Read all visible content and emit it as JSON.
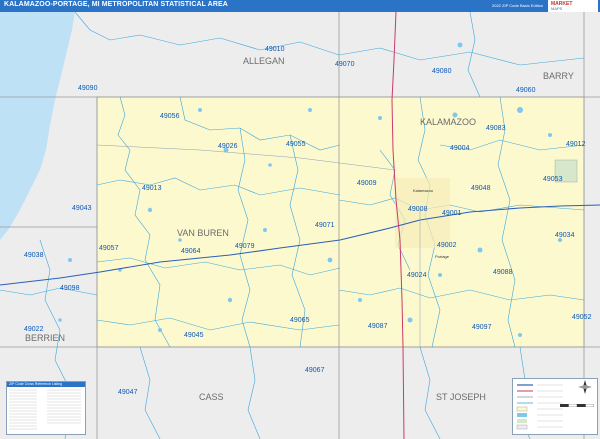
{
  "title": "KALAMAZOO-PORTAGE, MI METROPOLITAN STATISTICAL AREA",
  "edition": "2022 ZIP Code Basic Edition",
  "brand": {
    "line1": "MARKET",
    "line2": "MAPS"
  },
  "colors": {
    "title_bar": "#2b73c7",
    "msa_fill": "#fdf9cf",
    "outside_fill": "#ededed",
    "lake_michigan": "#bfe1f6",
    "zip_boundary": "#39a7dd",
    "county_boundary": "#9a9a9a",
    "highway": "#2c5fb7",
    "us_route": "#c93a6a",
    "zip_label": "#0b58b8",
    "county_label": "#6b6b6b"
  },
  "counties": [
    {
      "id": "allegan",
      "name": "ALLEGAN"
    },
    {
      "id": "barry",
      "name": "BARRY"
    },
    {
      "id": "kalamazoo",
      "name": "KALAMAZOO"
    },
    {
      "id": "van_buren",
      "name": "VAN BUREN"
    },
    {
      "id": "berrien",
      "name": "BERRIEN"
    },
    {
      "id": "cass",
      "name": "CASS"
    },
    {
      "id": "st_joseph",
      "name": "ST JOSEPH"
    }
  ],
  "zip_codes": [
    {
      "code": "49010"
    },
    {
      "code": "49070"
    },
    {
      "code": "49080"
    },
    {
      "code": "49090"
    },
    {
      "code": "49060"
    },
    {
      "code": "49056"
    },
    {
      "code": "49083"
    },
    {
      "code": "49026"
    },
    {
      "code": "49055"
    },
    {
      "code": "49004"
    },
    {
      "code": "49012"
    },
    {
      "code": "49013"
    },
    {
      "code": "49009"
    },
    {
      "code": "49048"
    },
    {
      "code": "49053"
    },
    {
      "code": "49043"
    },
    {
      "code": "49008"
    },
    {
      "code": "49001"
    },
    {
      "code": "49071"
    },
    {
      "code": "49057"
    },
    {
      "code": "49034"
    },
    {
      "code": "49002"
    },
    {
      "code": "49064"
    },
    {
      "code": "49079"
    },
    {
      "code": "49038"
    },
    {
      "code": "49024"
    },
    {
      "code": "49088"
    },
    {
      "code": "49098"
    },
    {
      "code": "49065"
    },
    {
      "code": "49087"
    },
    {
      "code": "49097"
    },
    {
      "code": "49052"
    },
    {
      "code": "49045"
    },
    {
      "code": "49022"
    },
    {
      "code": "49067"
    },
    {
      "code": "49047"
    }
  ],
  "city_labels": [
    {
      "name": "Kalamazoo"
    },
    {
      "name": "Portage"
    }
  ],
  "legend_table_title": "ZIP Code Cross Reference Listing"
}
